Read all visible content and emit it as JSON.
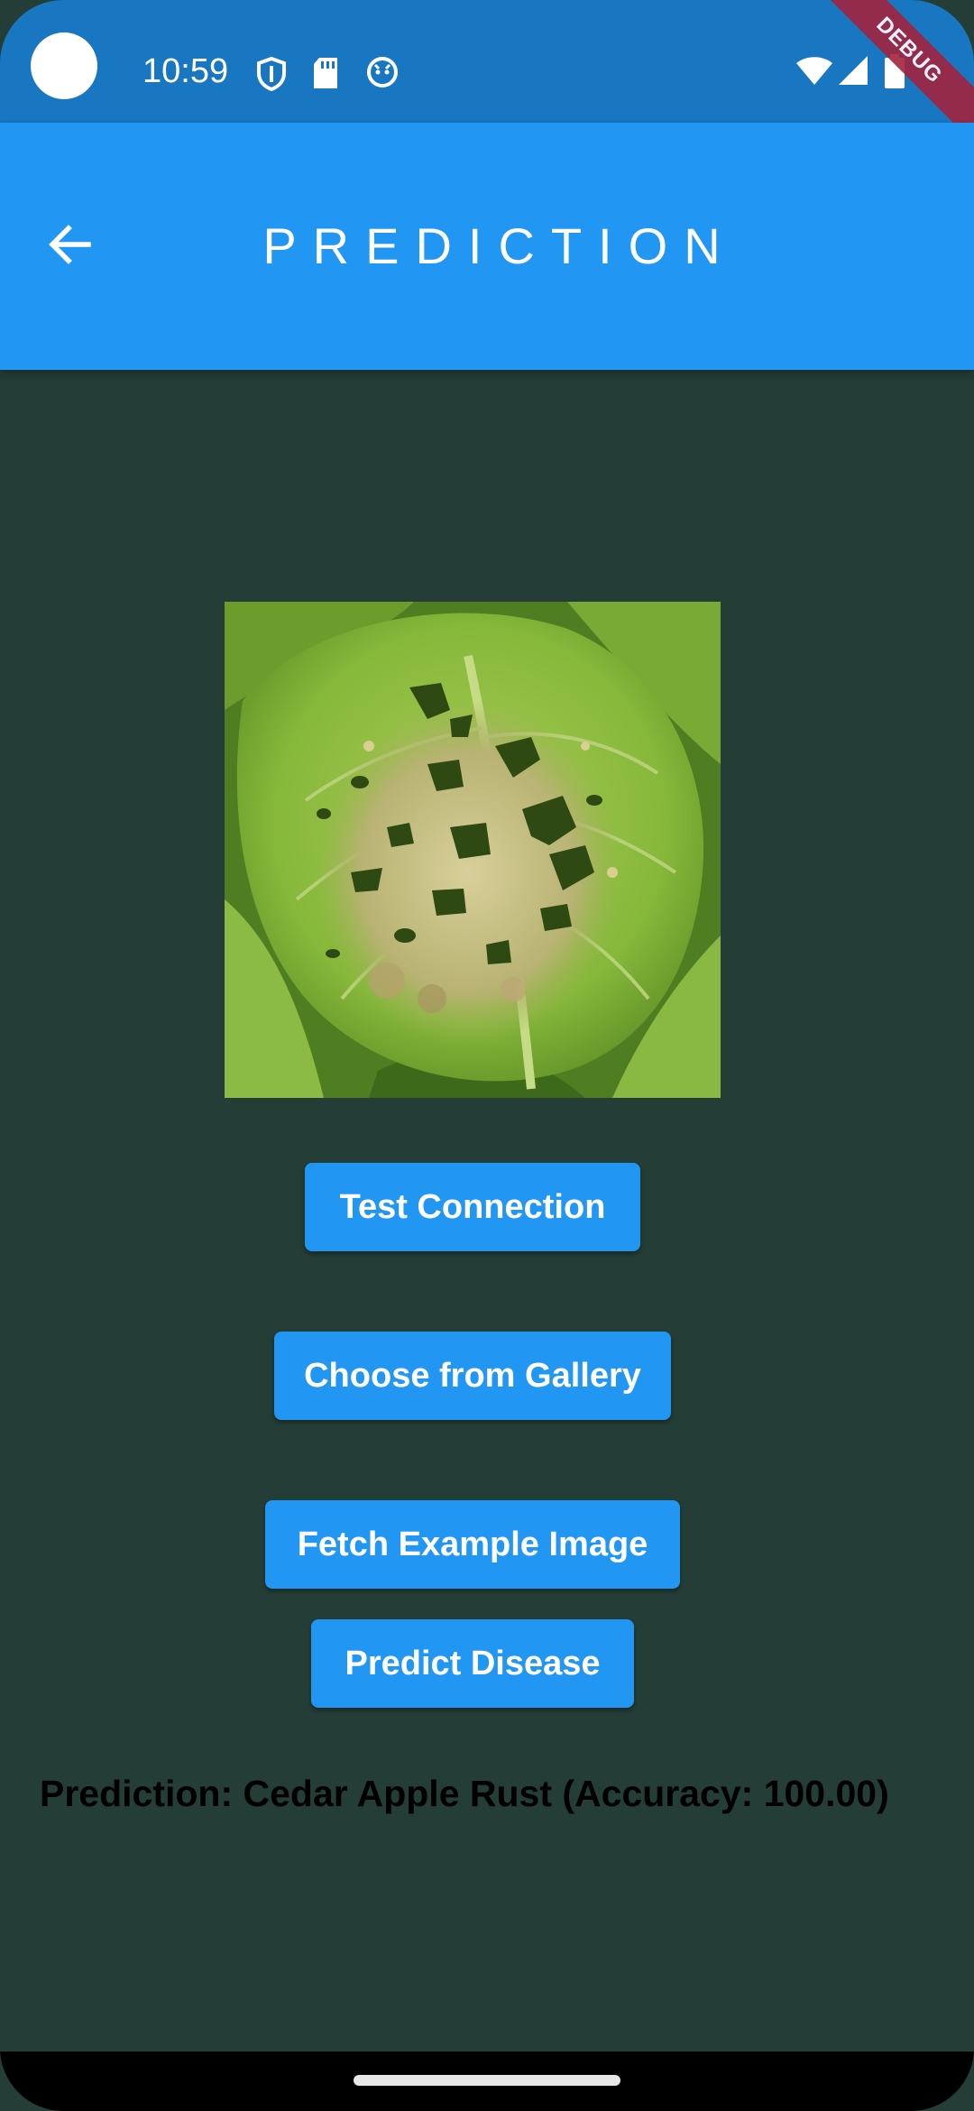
{
  "status_bar": {
    "time": "10:59",
    "left_icons": [
      "shield-icon",
      "sd-card-icon",
      "face-icon"
    ],
    "right_icons": [
      "wifi-icon",
      "signal-icon",
      "battery-icon"
    ],
    "debug_label": "DEBUG"
  },
  "app_bar": {
    "title": "PREDICTION",
    "back_icon": "arrow-left-icon",
    "color": "#2196f3"
  },
  "colors": {
    "background": "#243d36",
    "status_bar": "#1976c0",
    "button": "#2196f3",
    "debug_banner": "#a3243e"
  },
  "buttons": {
    "test_connection": "Test Connection",
    "choose_gallery": "Choose from Gallery",
    "fetch_example": "Fetch Example Image",
    "predict": "Predict Disease"
  },
  "result": {
    "prediction_text": "Prediction: Cedar Apple Rust (Accuracy: 100.00)"
  }
}
